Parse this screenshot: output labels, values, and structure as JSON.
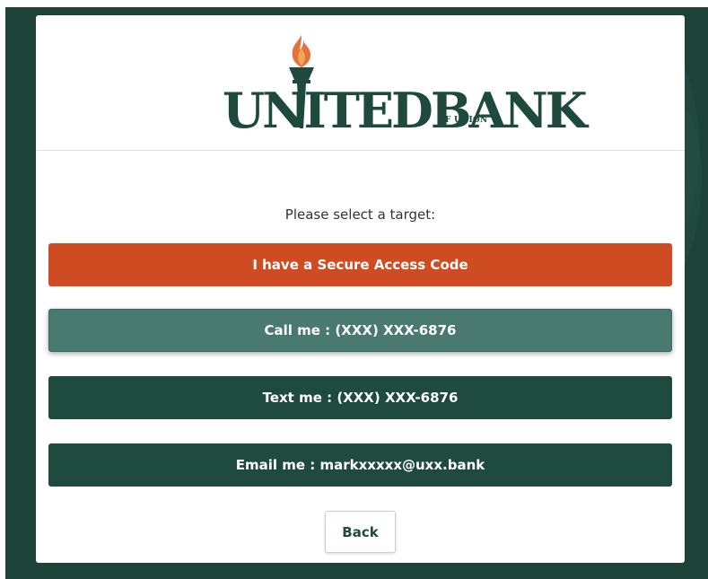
{
  "brand": {
    "logo_name": "UNITEDBANK",
    "logo_sub": "OF UNION",
    "colors": {
      "dark_green": "#1f4a3e",
      "medium_green": "#4a7a6f",
      "orange": "#cf4b22",
      "flame": "#e8703a"
    }
  },
  "prompt": "Please select a target:",
  "options": {
    "secure_code": "I have a Secure Access Code",
    "call": "Call me : (XXX) XXX-6876",
    "text": "Text me : (XXX) XXX-6876",
    "email": "Email me : markxxxxx@uxx.bank"
  },
  "back_label": "Back",
  "icons": {
    "logo_torch": "torch-icon"
  }
}
